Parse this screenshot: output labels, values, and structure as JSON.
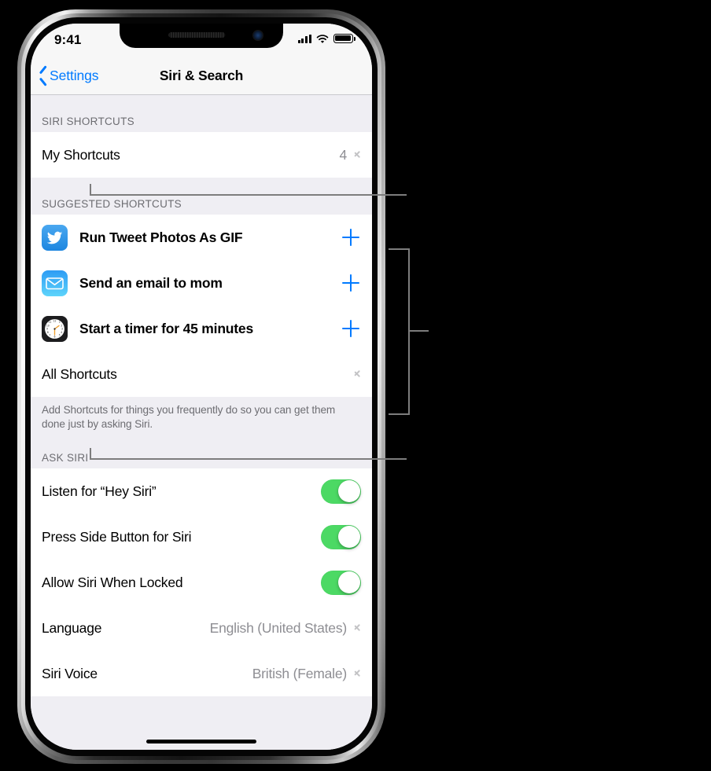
{
  "status_bar": {
    "time": "9:41",
    "signal_icon": "cellular-bars-icon",
    "wifi_icon": "wifi-icon",
    "battery_icon": "battery-full-icon"
  },
  "nav": {
    "back_label": "Settings",
    "title": "Siri & Search"
  },
  "sections": {
    "siri_shortcuts": {
      "header": "SIRI SHORTCUTS",
      "rows": [
        {
          "label": "My Shortcuts",
          "value": "4",
          "accessory": "chevron-right-icon"
        }
      ]
    },
    "suggested_shortcuts": {
      "header": "SUGGESTED SHORTCUTS",
      "rows": [
        {
          "label": "Run Tweet Photos As GIF",
          "icon": "twitter-app-icon",
          "accessory": "plus-icon"
        },
        {
          "label": "Send an email to mom",
          "icon": "mail-app-icon",
          "accessory": "plus-icon"
        },
        {
          "label": "Start a timer for 45 minutes",
          "icon": "clock-app-icon",
          "accessory": "plus-icon"
        }
      ],
      "all_row": {
        "label": "All Shortcuts",
        "accessory": "chevron-right-icon"
      },
      "footer": "Add Shortcuts for things you frequently do so you can get them done just by asking Siri."
    },
    "ask_siri": {
      "header": "ASK SIRI",
      "rows": [
        {
          "label": "Listen for “Hey Siri”",
          "type": "toggle",
          "on": true
        },
        {
          "label": "Press Side Button for Siri",
          "type": "toggle",
          "on": true
        },
        {
          "label": "Allow Siri When Locked",
          "type": "toggle",
          "on": true
        },
        {
          "label": "Language",
          "type": "value",
          "value": "English (United States)",
          "accessory": "chevron-right-icon"
        },
        {
          "label": "Siri Voice",
          "type": "value",
          "value": "British (Female)",
          "accessory": "chevron-right-icon"
        }
      ]
    }
  },
  "colors": {
    "accent_blue": "#007aff",
    "toggle_green": "#4cd964",
    "group_background": "#efeef3",
    "separator": "#d4d3d8",
    "secondary_text": "#8e8e93",
    "header_text": "#6d6d72",
    "callout_line": "#7d7d7d"
  },
  "callouts": {
    "my_shortcuts_leader": "leader-line-my-shortcuts",
    "suggested_bracket": "bracket-suggested-shortcuts",
    "all_shortcuts_leader": "leader-line-all-shortcuts"
  }
}
